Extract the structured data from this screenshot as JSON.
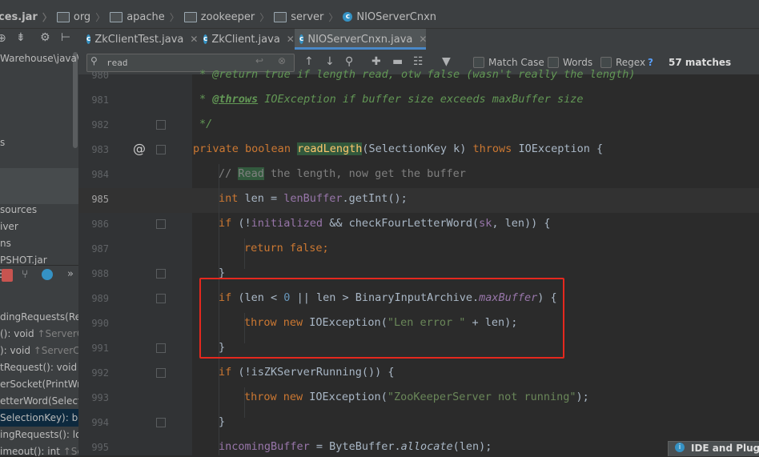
{
  "breadcrumb": {
    "items": [
      {
        "label": "ces.jar",
        "type": "jar"
      },
      {
        "label": "org",
        "type": "folder"
      },
      {
        "label": "apache",
        "type": "folder"
      },
      {
        "label": "zookeeper",
        "type": "folder"
      },
      {
        "label": "server",
        "type": "folder"
      },
      {
        "label": "NIOServerCnxn",
        "type": "class"
      }
    ]
  },
  "project_tree": {
    "items": [
      {
        "label": "Warehouse\\java\\"
      },
      {
        "label": "s"
      },
      {
        "label": "sources"
      },
      {
        "label": "iver"
      },
      {
        "label": "ns"
      },
      {
        "label": "PSHOT.jar"
      }
    ]
  },
  "structure": {
    "items": [
      {
        "label": "dingRequests(Rec",
        "suffix": ""
      },
      {
        "label": "(): void ",
        "suffix": "↑ServerCn"
      },
      {
        "label": "): void ",
        "suffix": "↑ServerCnx"
      },
      {
        "label": "tRequest(): void",
        "suffix": ""
      },
      {
        "label": "erSocket(PrintWri",
        "suffix": ""
      },
      {
        "label": "etterWord(Selectic",
        "suffix": ""
      },
      {
        "label": "SelectionKey): boo",
        "suffix": ""
      },
      {
        "label": "ingRequests(): lo",
        "suffix": ""
      },
      {
        "label": "imeout(): int ",
        "suffix": "↑Ser"
      }
    ]
  },
  "tabs": [
    {
      "label": "ZkClientTest.java",
      "active": false
    },
    {
      "label": "ZkClient.java",
      "active": false
    },
    {
      "label": "NIOServerCnxn.java",
      "active": true
    }
  ],
  "find": {
    "query": "read",
    "match_case_label": "Match Case",
    "words_label": "Words",
    "regex_label": "Regex",
    "help": "?",
    "matches": "57 matches"
  },
  "gutter": {
    "lines": [
      "980",
      "981",
      "982",
      "983",
      "984",
      "985",
      "986",
      "987",
      "988",
      "989",
      "990",
      "991",
      "992",
      "993",
      "994",
      "995"
    ],
    "current_line": "985",
    "override_marker": "@"
  },
  "code": {
    "l980": "* @return true if length read, otw false (wasn't really the length)",
    "l981_tag": "@throws",
    "l981_rest": " IOException if buffer size exceeds maxBuffer size",
    "l982": "*/",
    "l983": [
      "private",
      "boolean",
      "readLength",
      "(SelectionKey k) ",
      "throws",
      " IOException {"
    ],
    "l984": [
      "// ",
      "Read",
      " the length, now get the buffer"
    ],
    "l985": [
      "int",
      " len = ",
      "lenBuffer",
      ".getInt();"
    ],
    "l986": [
      "if",
      " (!",
      "initialized",
      " && checkFourLetterWord(",
      "sk",
      ", len)) {"
    ],
    "l987": [
      "return false",
      ";"
    ],
    "l988": "}",
    "l989": [
      "if",
      " (len < ",
      "0",
      " || len > BinaryInputArchive.",
      "maxBuffer",
      ") {"
    ],
    "l990": [
      "throw new",
      " IOException(",
      "\"Len error \"",
      " + len);"
    ],
    "l991": "}",
    "l992": [
      "if",
      " (!isZKServerRunning()) {"
    ],
    "l993": [
      "throw new",
      " IOException(",
      "\"ZooKeeperServer not running\"",
      ");"
    ],
    "l994": "}",
    "l995": [
      "incomingBuffer",
      " = ByteBuffer.",
      "allocate",
      "(len);"
    ]
  },
  "popup": {
    "label": "IDE and Plugi"
  },
  "colors": {
    "highlight_box": "#e5281e",
    "accent_tab": "#4a88c7"
  }
}
